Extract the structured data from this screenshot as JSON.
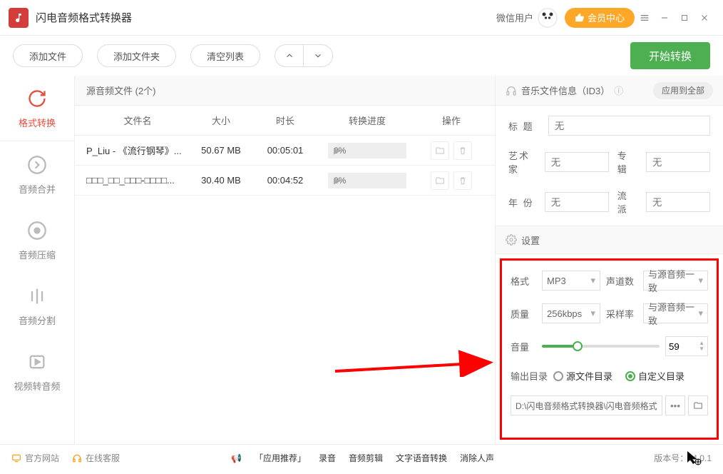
{
  "titlebar": {
    "app_title": "闪电音频格式转换器",
    "wx_user": "微信用户",
    "vip_label": "会员中心"
  },
  "toolbar": {
    "add_file": "添加文件",
    "add_folder": "添加文件夹",
    "clear": "清空列表",
    "start": "开始转换"
  },
  "sidebar": [
    {
      "label": "格式转换"
    },
    {
      "label": "音频合并"
    },
    {
      "label": "音频压缩"
    },
    {
      "label": "音频分割"
    },
    {
      "label": "视频转音频"
    }
  ],
  "source_header": "源音频文件 (2个)",
  "columns": {
    "name": "文件名",
    "size": "大小",
    "dur": "时长",
    "prog": "转换进度",
    "op": "操作"
  },
  "files": [
    {
      "name": "P_Liu - 《流行钢琴》...",
      "size": "50.67 MB",
      "dur": "00:05:01",
      "prog": "0%"
    },
    {
      "name": "□□□_□□_□□□-□□□□...",
      "size": "30.40 MB",
      "dur": "00:04:52",
      "prog": "0%"
    }
  ],
  "id3": {
    "header": "音乐文件信息（ID3）",
    "apply_all": "应用到全部",
    "title_lbl": "标  题",
    "artist_lbl": "艺术家",
    "album_lbl": "专辑",
    "year_lbl": "年  份",
    "genre_lbl": "流派",
    "placeholder": "无"
  },
  "settings": {
    "header": "设置",
    "format_lbl": "格式",
    "format_val": "MP3",
    "channels_lbl": "声道数",
    "channels_val": "与源音频一致",
    "quality_lbl": "质量",
    "quality_val": "256kbps",
    "sample_lbl": "采样率",
    "sample_val": "与源音频一致",
    "volume_lbl": "音量",
    "volume_val": "59",
    "outdir_lbl": "输出目录",
    "radio_src": "源文件目录",
    "radio_custom": "自定义目录",
    "outpath": "D:\\闪电音频格式转换器\\闪电音频格式转换器"
  },
  "footer": {
    "site": "官方网站",
    "support": "在线客服",
    "rec_lbl": "「应用推荐」",
    "rec1": "录音",
    "rec2": "音频剪辑",
    "rec3": "文字语音转换",
    "rec4": "消除人声",
    "version": "版本号：v4.0.1"
  }
}
